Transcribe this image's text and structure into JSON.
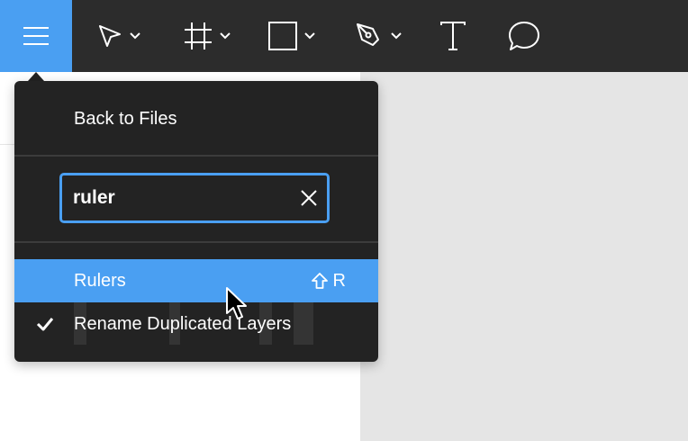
{
  "toolbar": {
    "tools": [
      {
        "icon": "hamburger-menu-icon"
      },
      {
        "icon": "move-arrow-icon"
      },
      {
        "icon": "frame-icon"
      },
      {
        "icon": "rectangle-icon"
      },
      {
        "icon": "pen-icon"
      },
      {
        "icon": "text-icon"
      },
      {
        "icon": "comment-icon"
      }
    ]
  },
  "menu": {
    "back_to_files": "Back to Files",
    "search": {
      "value": "ruler",
      "placeholder": ""
    },
    "results": [
      {
        "label": "Rulers",
        "shortcut_key": "R",
        "shortcut_modifier": "shift-icon",
        "highlighted": true
      },
      {
        "label": "Rename Duplicated Layers",
        "checked": true
      }
    ]
  },
  "colors": {
    "toolbar_bg": "#2c2c2c",
    "accent": "#4a9ff2",
    "menu_bg": "#232323",
    "canvas_bg": "#e5e5e5"
  }
}
